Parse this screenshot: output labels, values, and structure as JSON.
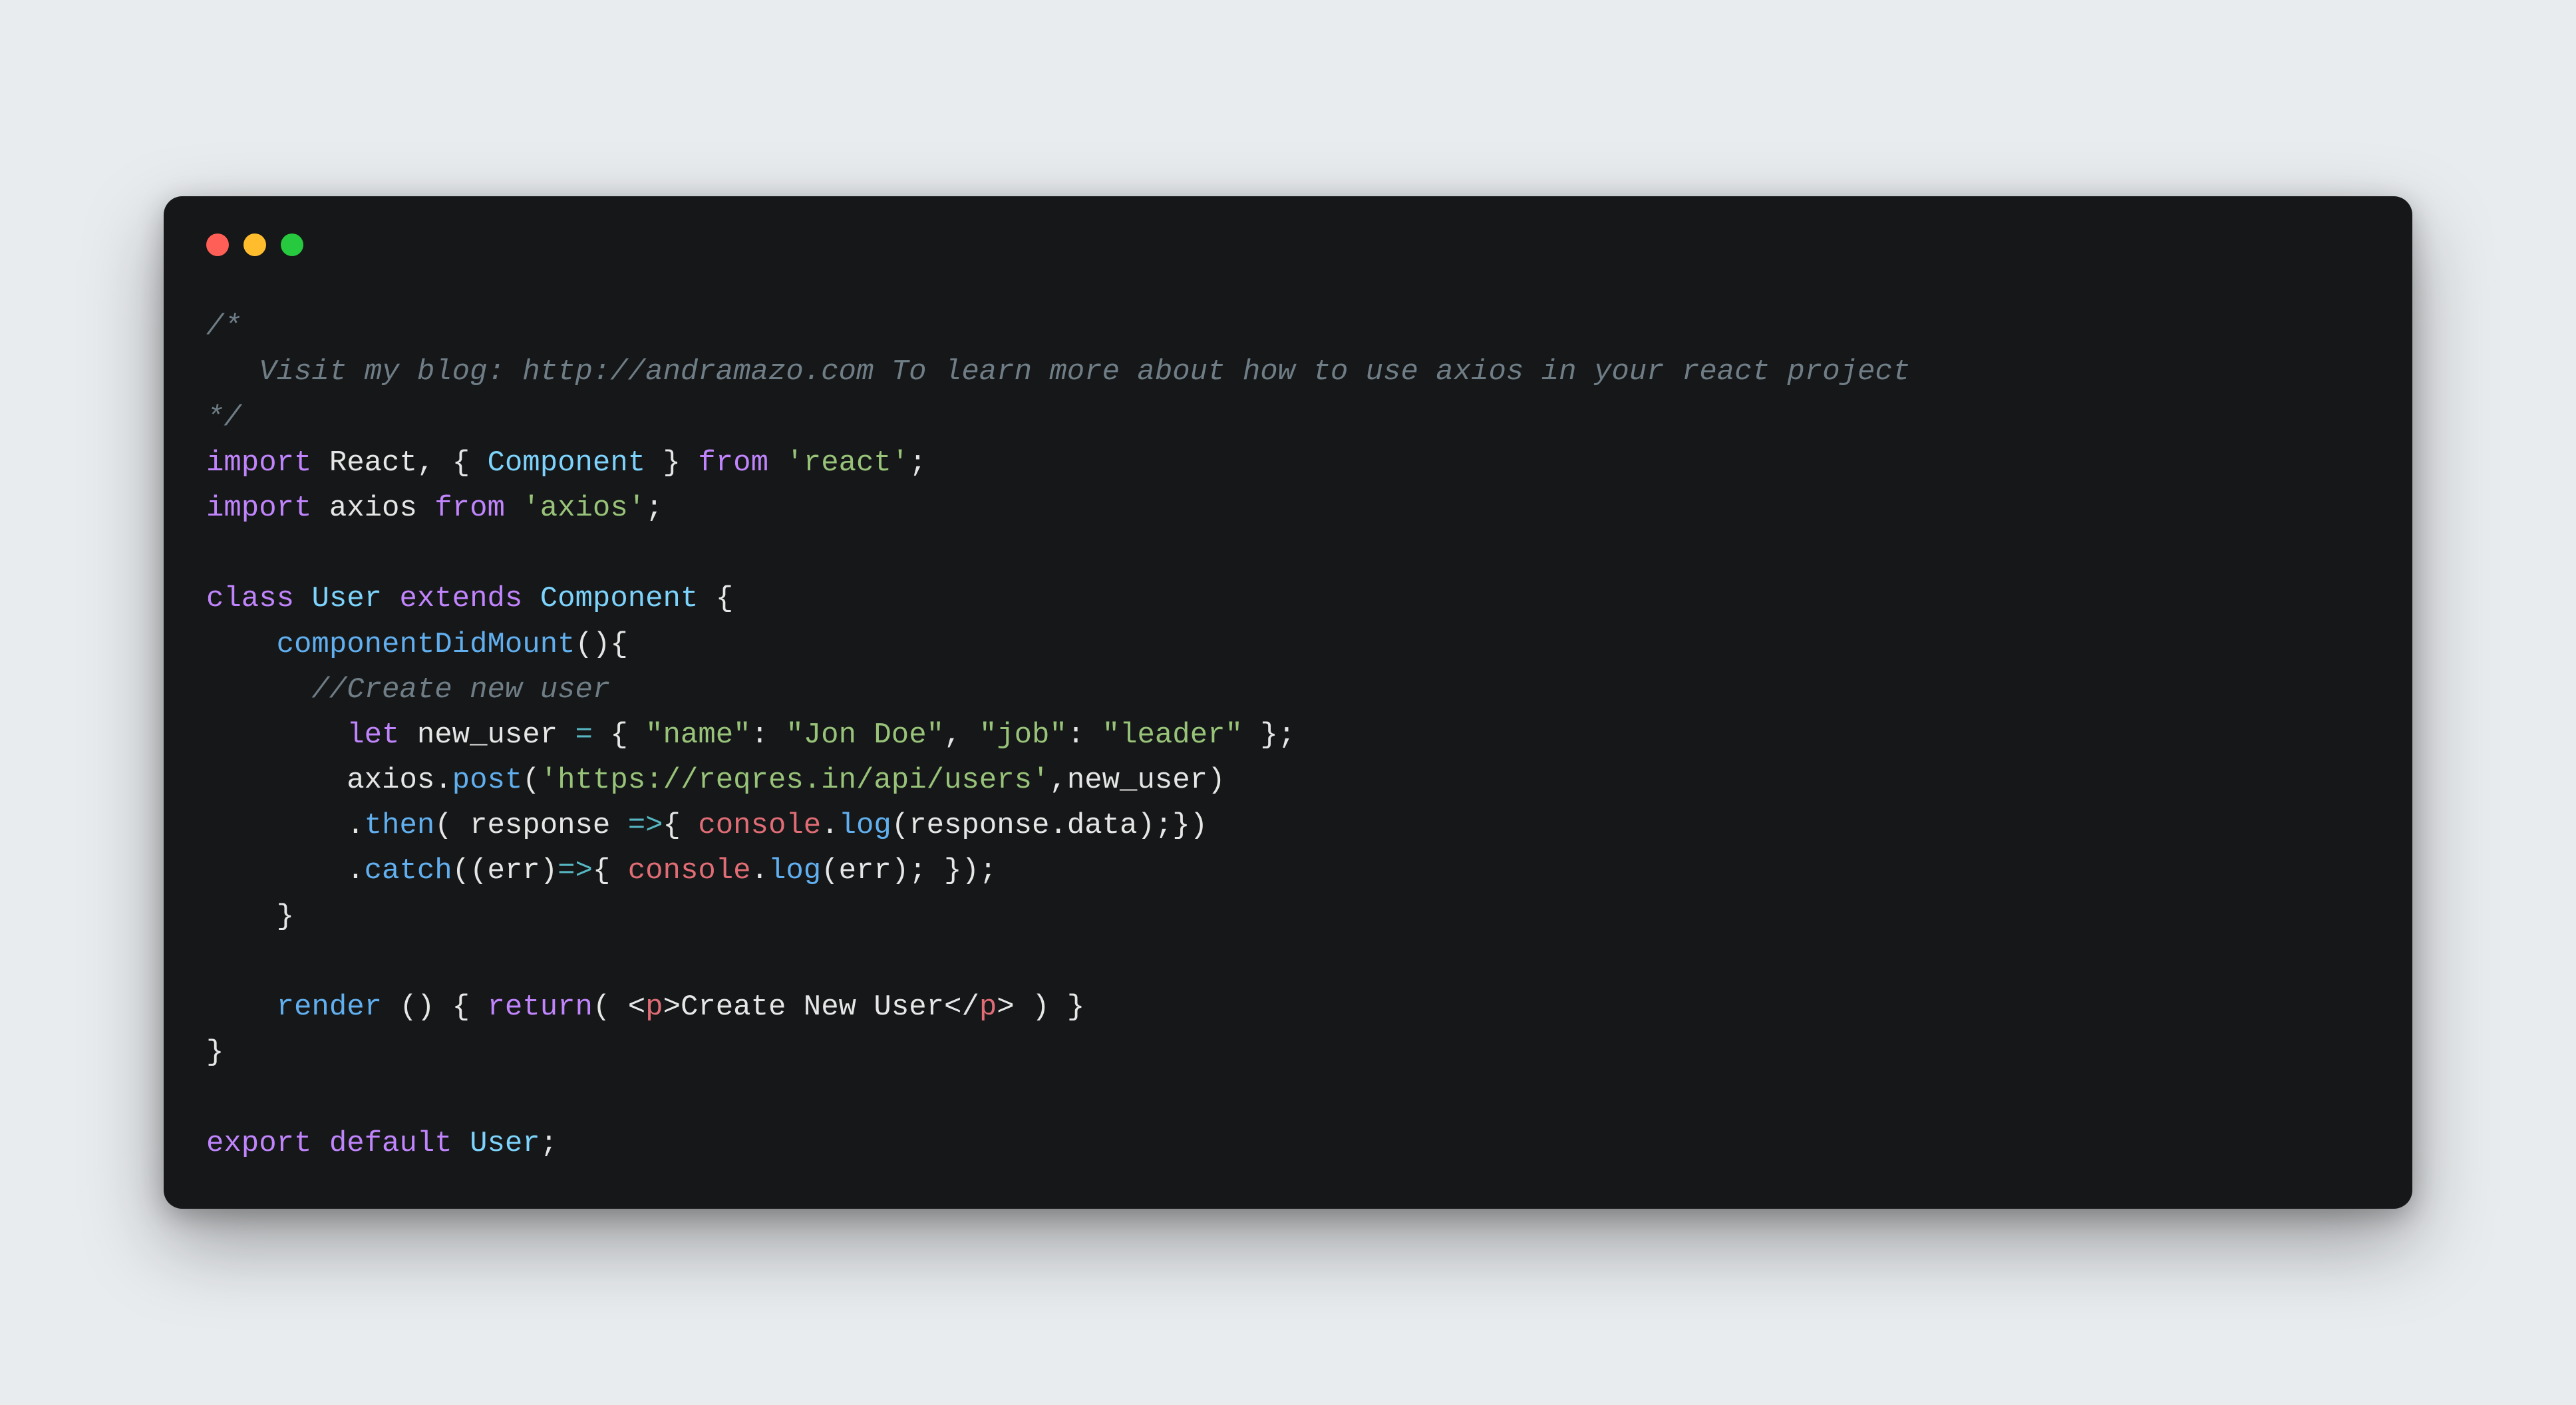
{
  "traffic": {
    "red": "#ff5f56",
    "yellow": "#ffbd2e",
    "green": "#27c93f"
  },
  "code": {
    "comment_open": "/*",
    "comment_body": "   Visit my blog: http://andramazo.com To learn more about how to use axios in your react project",
    "comment_close": "*/",
    "l4": {
      "import": "import",
      "react": "React",
      "comma": ",",
      "brace_open": "{",
      "component": "Component",
      "brace_close": "}",
      "from": "from",
      "module": "'react'",
      "semi": ";"
    },
    "l5": {
      "import": "import",
      "axios": "axios",
      "from": "from",
      "module": "'axios'",
      "semi": ";"
    },
    "l7": {
      "class": "class",
      "user": "User",
      "extends": "extends",
      "component": "Component",
      "brace_open": "{"
    },
    "l8": {
      "fn": "componentDidMount",
      "parens": "()",
      "brace": "{"
    },
    "l9": {
      "comment": "//Create new user"
    },
    "l10": {
      "let": "let",
      "name": "new_user",
      "eq": "=",
      "brace_open": "{",
      "k1": "\"name\"",
      "colon1": ":",
      "v1": "\"Jon Doe\"",
      "comma": ",",
      "k2": "\"job\"",
      "colon2": ":",
      "v2": "\"leader\"",
      "brace_close": "}",
      "semi": ";"
    },
    "l11": {
      "axios": "axios",
      "dot": ".",
      "post": "post",
      "paren_open": "(",
      "url": "'https://reqres.in/api/users'",
      "comma": ",",
      "arg": "new_user",
      "paren_close": ")"
    },
    "l12": {
      "dot": ".",
      "then": "then",
      "paren_open": "(",
      "response": "response",
      "arrow": " =>",
      "brace_open": "{",
      "console": "console",
      "dot2": ".",
      "log": "log",
      "paren2_open": "(",
      "response2": "response",
      "dot3": ".",
      "data": "data",
      "paren2_close": ")",
      "semi": ";",
      "brace_close": "}",
      "paren_close": ")"
    },
    "l13": {
      "dot": ".",
      "catch": "catch",
      "paren_open": "((",
      "err": "err",
      "paren_mid": ")",
      "arrow": "=>",
      "brace_open": "{",
      "console": "console",
      "dot2": ".",
      "log": "log",
      "paren2_open": "(",
      "err2": "err",
      "paren2_close": ")",
      "semi": ";",
      "brace_close": " }",
      "paren_close": ")",
      "semi2": ";"
    },
    "l14": {
      "brace": "}"
    },
    "l16": {
      "render": "render",
      "parens": " ()",
      "brace_open": " {",
      "return": "return",
      "paren_open": "(",
      "tag_open_l": " <",
      "tag_open_name": "p",
      "tag_open_r": ">",
      "text": "Create New User",
      "tag_close_l": "</",
      "tag_close_name": "p",
      "tag_close_r": ">",
      "paren_close": " )",
      "brace_close": " }"
    },
    "l17": {
      "brace": "}"
    },
    "l19": {
      "export": "export",
      "default": "default",
      "user": "User",
      "semi": ";"
    }
  }
}
